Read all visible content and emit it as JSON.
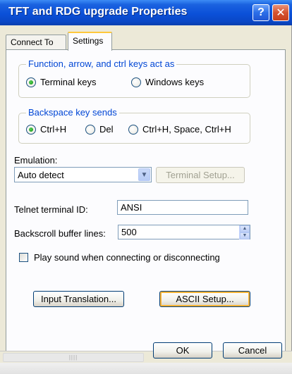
{
  "window": {
    "title": "TFT and RDG upgrade Properties"
  },
  "titlebar": {
    "help": "?",
    "close": "✕"
  },
  "tabs": [
    {
      "label": "Connect To"
    },
    {
      "label": "Settings"
    }
  ],
  "settings": {
    "function_keys": {
      "title": "Function, arrow, and ctrl keys act as",
      "options": [
        "Terminal keys",
        "Windows keys"
      ],
      "selected": "Terminal keys"
    },
    "backspace": {
      "title": "Backspace key sends",
      "options": [
        "Ctrl+H",
        "Del",
        "Ctrl+H, Space, Ctrl+H"
      ],
      "selected": "Ctrl+H"
    },
    "emulation": {
      "label": "Emulation:",
      "value": "Auto detect",
      "setup_button": "Terminal Setup..."
    },
    "telnet": {
      "label": "Telnet terminal ID:",
      "value": "ANSI"
    },
    "backscroll": {
      "label": "Backscroll buffer lines:",
      "value": "500"
    },
    "play_sound": {
      "label": "Play sound when connecting or disconnecting",
      "checked": false
    },
    "input_translation_button": "Input Translation...",
    "ascii_setup_button": "ASCII Setup..."
  },
  "footer": {
    "ok": "OK",
    "cancel": "Cancel"
  }
}
